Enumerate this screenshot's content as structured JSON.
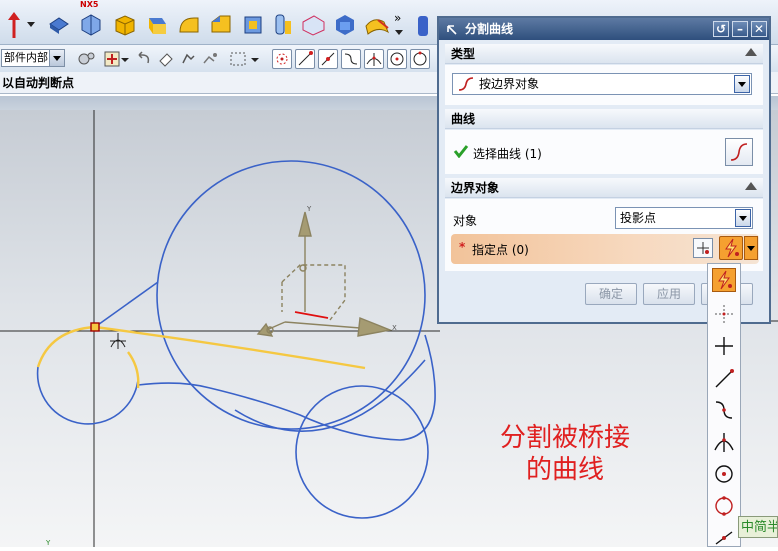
{
  "toolbar": {
    "part_combo_value": "部件内部",
    "nx_badge": "NX5"
  },
  "status": {
    "prompt": "以自动判断点"
  },
  "dialog": {
    "title": "分割曲线",
    "sections": {
      "type": "类型",
      "curve": "曲线",
      "boundary": "边界对象"
    },
    "type_value": "按边界对象",
    "select_curve_label": "选择曲线 (1)",
    "object_label": "对象",
    "object_value": "投影点",
    "required_mark": "*",
    "specify_point_label": "指定点 (0)",
    "buttons": {
      "ok": "确定",
      "apply": "应用"
    }
  },
  "annotation": {
    "line1": "分割被桥接",
    "line2": "的曲线"
  },
  "ime_badge": "中简半",
  "colors": {
    "curve_blue": "#3a62c8",
    "highlight_yellow": "#f5c842",
    "axis_olive": "#8c8360",
    "annotation_red": "#e02020",
    "title_blue": "#2f4f7d"
  },
  "icons": [
    "pencil-arrow-icon",
    "cube-icon",
    "snap-point-icon",
    "curve-icon",
    "bridge-icon",
    "flash-point-icon"
  ]
}
